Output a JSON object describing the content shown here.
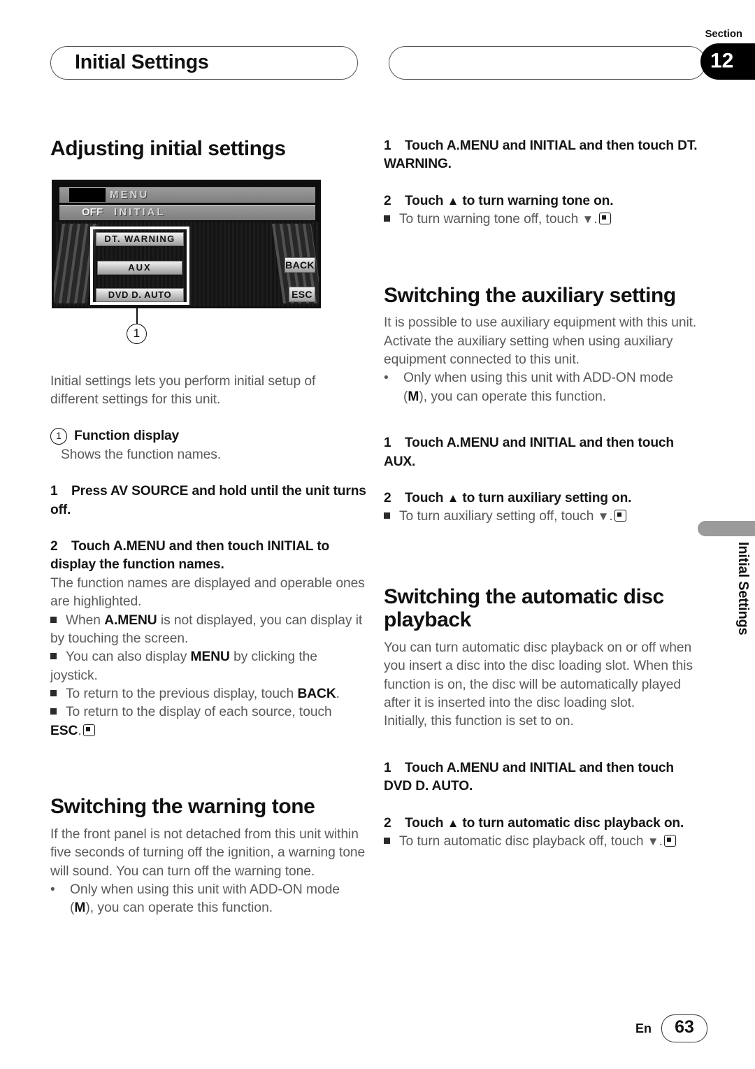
{
  "header": {
    "left_pill_title": "Initial Settings",
    "right_pill_title": "",
    "section_word": "Section",
    "section_number": "12"
  },
  "edge_tab": {
    "label": "Initial Settings"
  },
  "footer": {
    "language": "En",
    "page_number": "63"
  },
  "left_column": {
    "heading": "Adjusting initial settings",
    "device_screen": {
      "menu_label": "MENU",
      "initial_label": "INITIAL",
      "off_label": "OFF",
      "keys": [
        "DT. WARNING",
        "AUX",
        "DVD  D. AUTO",
        "BACK",
        "ESC"
      ],
      "callout_number": "1"
    },
    "intro": "Initial settings lets you perform initial setup of different settings for this unit.",
    "callout_marker": "1",
    "callout_title": "Function display",
    "callout_desc": "Shows the function names.",
    "step1_num": "1",
    "step1_text": "Press AV SOURCE and hold until the unit turns off.",
    "step2_num": "2",
    "step2_text": "Touch A.MENU and then touch INITIAL to display the function names.",
    "step2_body": "The function names are displayed and operable ones are highlighted.",
    "notes": [
      {
        "pre": "When ",
        "bold": "A.MENU",
        "post": " is not displayed, you can display it by touching the screen."
      },
      {
        "pre": "You can also display ",
        "bold": "MENU",
        "post": " by clicking the joystick."
      },
      {
        "pre": "To return to the previous display, touch ",
        "bold": "BACK",
        "post": "."
      },
      {
        "pre": "To return to the display of each source, touch ",
        "bold": "ESC",
        "post": "."
      }
    ],
    "warning_heading": "Switching the warning tone",
    "warning_body": "If the front panel is not detached from this unit within five seconds of turning off the ignition, a warning tone will sound. You can turn off the warning tone.",
    "warning_bullet_pre": "Only when using this unit with ADD-ON mode (",
    "warning_bullet_bold": "M",
    "warning_bullet_post": "), you can operate this function."
  },
  "right_column": {
    "warn_step1_num": "1",
    "warn_step1_text": "Touch A.MENU and INITIAL and then touch DT. WARNING.",
    "warn_step2_num": "2",
    "warn_step2_pre": "Touch ",
    "warn_step2_post": " to turn warning tone on.",
    "warn_note_pre": "To turn warning tone off, touch ",
    "warn_note_post": ".",
    "aux_heading": "Switching the auxiliary setting",
    "aux_body": "It is possible to use auxiliary equipment with this unit. Activate the auxiliary setting when using auxiliary equipment connected to this unit.",
    "aux_bullet_pre": "Only when using this unit with ADD-ON mode (",
    "aux_bullet_bold": "M",
    "aux_bullet_post": "), you can operate this function.",
    "aux_step1_num": "1",
    "aux_step1_text": "Touch A.MENU and INITIAL and then touch AUX.",
    "aux_step2_num": "2",
    "aux_step2_pre": "Touch ",
    "aux_step2_post": " to turn auxiliary setting on.",
    "aux_note_pre": "To turn auxiliary setting off, touch ",
    "aux_note_post": ".",
    "disc_heading": "Switching the automatic disc playback",
    "disc_body": "You can turn automatic disc playback on or off when you insert a disc into the disc loading slot. When this function is on, the disc will be automatically played after it is inserted into the disc loading slot.",
    "disc_body2": "Initially, this function is set to on.",
    "disc_step1_num": "1",
    "disc_step1_text": "Touch A.MENU and INITIAL and then touch DVD D. AUTO.",
    "disc_step2_num": "2",
    "disc_step2_pre": "Touch ",
    "disc_step2_post": " to turn automatic disc playback on.",
    "disc_note_pre": "To turn automatic disc playback off, touch ",
    "disc_note_post": "."
  },
  "glyphs": {
    "triangle_up": "▲",
    "triangle_down": "▼"
  }
}
